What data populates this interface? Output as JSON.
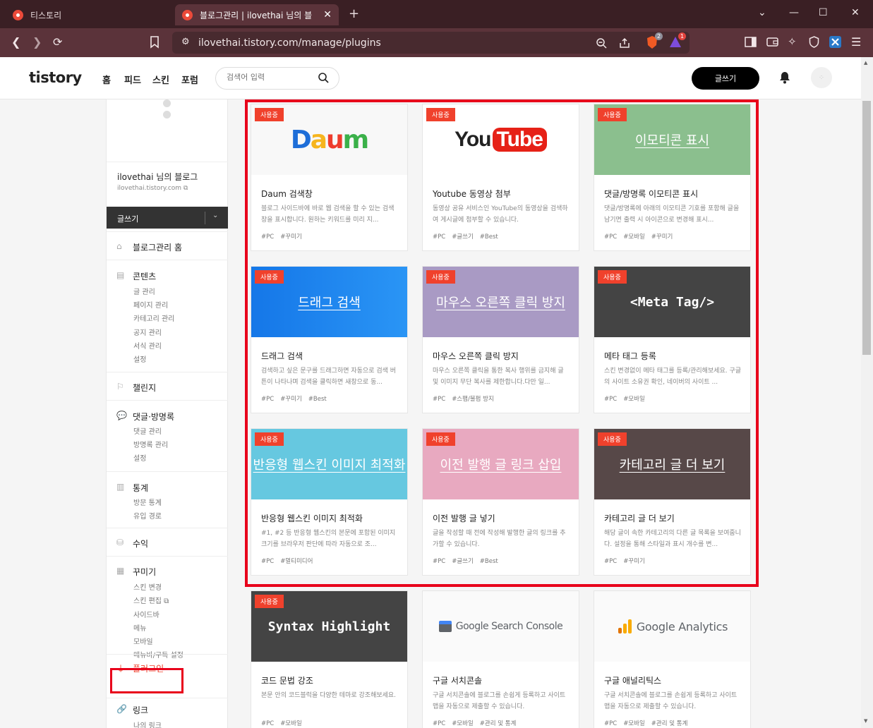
{
  "browser": {
    "tabs": [
      {
        "title": "티스토리",
        "active": false
      },
      {
        "title": "블로그관리 | ilovethai 님의 블",
        "active": true
      }
    ],
    "url": "ilovethai.tistory.com/manage/plugins",
    "brave_badge": "2",
    "alert_badge": "1"
  },
  "header": {
    "logo": "tistory",
    "nav": [
      "홈",
      "피드",
      "스킨",
      "포럼"
    ],
    "search_placeholder": "검색어 입력",
    "write_button": "글쓰기"
  },
  "sidebar": {
    "blog_name": "ilovethai 님의 블로그",
    "blog_url": "ilovethai.tistory.com",
    "write_button": "글쓰기",
    "sections": [
      {
        "title": "블로그관리 홈",
        "items": []
      },
      {
        "title": "콘텐츠",
        "items": [
          "글 관리",
          "페이지 관리",
          "카테고리 관리",
          "공지 관리",
          "서식 관리",
          "설정"
        ]
      },
      {
        "title": "챌린지",
        "items": []
      },
      {
        "title": "댓글·방명록",
        "items": [
          "댓글 관리",
          "방명록 관리",
          "설정"
        ]
      },
      {
        "title": "통계",
        "items": [
          "방문 통계",
          "유입 경로"
        ]
      },
      {
        "title": "수익",
        "items": []
      },
      {
        "title": "꾸미기",
        "items": [
          "스킨 변경",
          "스킨 편집",
          "사이드바",
          "메뉴",
          "모바일",
          "메뉴바/구독 설정"
        ]
      },
      {
        "title": "플러그인",
        "items": []
      },
      {
        "title": "링크",
        "items": [
          "나의 링크"
        ]
      }
    ]
  },
  "plugins": [
    {
      "badge": "사용중",
      "thumb": "Daum",
      "title": "Daum 검색창",
      "desc": "블로그 사이드바에 바로 웹 검색을 할 수 있는 검색창을 표시합니다. 원하는 키워드를 미리 지...",
      "tags": [
        "#PC",
        "#꾸미기"
      ]
    },
    {
      "badge": "사용중",
      "thumb": "YouTube",
      "title": "Youtube 동영상 첨부",
      "desc": "동영상 공유 서비스인 YouTube의 동영상을 검색하여 게시글에 첨부할 수 있습니다.",
      "tags": [
        "#PC",
        "#글쓰기",
        "#Best"
      ]
    },
    {
      "badge": "사용중",
      "thumb": "이모티콘 표시",
      "title": "댓글/방명록 이모티콘 표시",
      "desc": "댓글/방명록에 아래의 이모티콘 기호를 포함해 글을 남기면 출력 시 아이콘으로 변경해 표시...",
      "tags": [
        "#PC",
        "#모바일",
        "#꾸미기"
      ]
    },
    {
      "badge": "사용중",
      "thumb": "드래그 검색",
      "title": "드래그 검색",
      "desc": "검색하고 싶은 문구를 드래그하면 자동으로 검색 버튼이 나타나며 검색을 클릭하면 새창으로 동...",
      "tags": [
        "#PC",
        "#꾸미기",
        "#Best"
      ]
    },
    {
      "badge": "사용중",
      "thumb": "마우스 오른쪽 클릭 방지",
      "title": "마우스 오른쪽 클릭 방지",
      "desc": "마우스 오른쪽 클릭을 통한 복사 행위를 금지해 글 및 이미지 무단 복사를 제한합니다.다만 일...",
      "tags": [
        "#PC",
        "#스팸/불펌 방지"
      ]
    },
    {
      "badge": "사용중",
      "thumb": "<Meta Tag/>",
      "title": "메타 태그 등록",
      "desc": "스킨 변경없이 메타 태그를 등록/관리해보세요. 구글의 사이트 소유권 확인, 네이버의 사이트 ...",
      "tags": [
        "#PC",
        "#모바일"
      ]
    },
    {
      "badge": "사용중",
      "thumb": "반응형 웹스킨 이미지 최적화",
      "title": "반응형 웹스킨 이미지 최적화",
      "desc": "#1, #2 등 반응형 웹스킨의 본문에 포함된 이미지 크기를 브라우저 판단에 따라 자동으로 조...",
      "tags": [
        "#PC",
        "#멀티미디어"
      ]
    },
    {
      "badge": "사용중",
      "thumb": "이전 발행 글 링크 삽입",
      "title": "이전 발행 글 넣기",
      "desc": "글을 작성할 때 전에 작성해 발행한 글의 링크를 추가할 수 있습니다.",
      "tags": [
        "#PC",
        "#글쓰기",
        "#Best"
      ]
    },
    {
      "badge": "사용중",
      "thumb": "카테고리 글 더 보기",
      "title": "카테고리 글 더 보기",
      "desc": "해당 글이 속한 카테고리의 다른 글 목록을 보여줍니다. 설정을 통해 스타일과 표시 개수를 변...",
      "tags": [
        "#PC",
        "#꾸미기"
      ]
    },
    {
      "badge": "사용중",
      "thumb": "Syntax Highlight",
      "title": "코드 문법 강조",
      "desc": "본문 안의 코드블럭을 다양한 테마로 강조해보세요.",
      "tags": [
        "#PC",
        "#모바일"
      ]
    },
    {
      "badge": "",
      "thumb": "Google Search Console",
      "title": "구글 서치콘솔",
      "desc": "구글 서치콘솔에 블로그를 손쉽게 등록하고 사이트맵을 자동으로 제출할 수 있습니다.",
      "tags": [
        "#PC",
        "#모바일",
        "#관리 및 통계"
      ]
    },
    {
      "badge": "",
      "thumb": "Google Analytics",
      "title": "구글 애널리틱스",
      "desc": "구글 서치콘솔에 블로그를 손쉽게 등록하고 사이트맵을 자동으로 제출할 수 있습니다.",
      "tags": [
        "#PC",
        "#모바일",
        "#관리 및 통계"
      ]
    }
  ],
  "colors": {
    "accent": "#f0412c",
    "highlight": "#e8001b",
    "daum_blue": "#1e6ed8",
    "youtube_red": "#e62117",
    "emoticon_bg": "#8bbf8e",
    "drag_bg": "#1b86f0",
    "mouse_bg": "#a99ac4",
    "meta_bg": "#444444",
    "responsive_bg": "#66c8e0",
    "prevpost_bg": "#e8a9c0",
    "category_bg": "#574848",
    "syntax_bg": "#444444"
  }
}
